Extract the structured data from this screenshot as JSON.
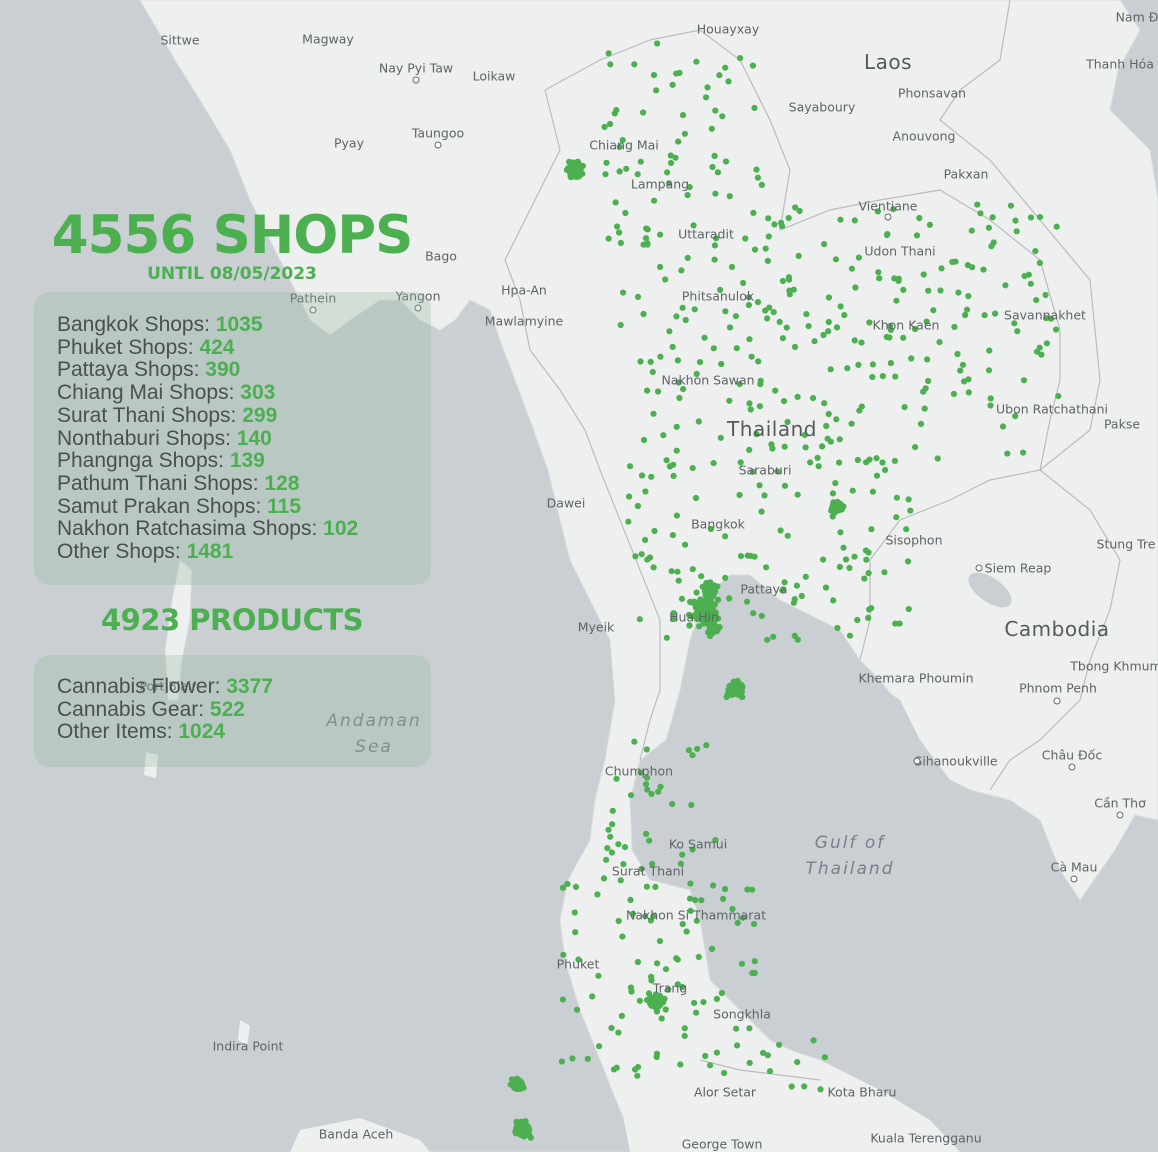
{
  "colors": {
    "sea": "#c9cfd3",
    "land": "#eeefef",
    "shop_dot": "#4caf50",
    "accent": "#4caf50",
    "panel": "rgba(143,184,150,0.28)"
  },
  "summary": {
    "shops_headline": "4556 SHOPS",
    "until": "UNTIL 08/05/2023",
    "products_headline": "4923 PRODUCTS"
  },
  "shops": [
    {
      "label": "Bangkok Shops: ",
      "value": "1035"
    },
    {
      "label": "Phuket Shops: ",
      "value": "424"
    },
    {
      "label": "Pattaya Shops: ",
      "value": "390"
    },
    {
      "label": "Chiang Mai Shops: ",
      "value": "303"
    },
    {
      "label": "Surat Thani Shops: ",
      "value": "299"
    },
    {
      "label": "Nonthaburi Shops: ",
      "value": "140"
    },
    {
      "label": "Phangnga Shops: ",
      "value": "139"
    },
    {
      "label": "Pathum Thani Shops: ",
      "value": "128"
    },
    {
      "label": "Samut Prakan Shops: ",
      "value": "115"
    },
    {
      "label": "Nakhon Ratchasima Shops: ",
      "value": "102"
    },
    {
      "label": "Other Shops: ",
      "value": "1481"
    }
  ],
  "products": [
    {
      "label": "Cannabis Flower: ",
      "value": "3377"
    },
    {
      "label": "Cannabis Gear: ",
      "value": "522"
    },
    {
      "label": "Other Items: ",
      "value": "1024"
    }
  ],
  "map_labels": {
    "countries": [
      "Laos",
      "Thailand",
      "Cambodia"
    ],
    "water": [
      "Andaman Sea",
      "Gulf of Thailand"
    ],
    "places": [
      "Houayxay",
      "Nam Đ",
      "Sittwe",
      "Magway",
      "Nay Pyi Taw",
      "Loikaw",
      "Thanh Hóa",
      "Phonsavan",
      "Sayaboury",
      "Pyay",
      "Taungoo",
      "Anouvong",
      "Chiang Mai",
      "Lampang",
      "Pakxan",
      "Vientiane",
      "Uttaradit",
      "Udon Thani",
      "Bago",
      "Pathein",
      "Yangon",
      "Hpa-An",
      "Phitsanulok",
      "Mawlamyine",
      "Khon Kaen",
      "Savannakhet",
      "Nakhon Sawan",
      "Ubon Ratchathani",
      "Pakse",
      "Saraburi",
      "Dawei",
      "Bangkok",
      "Sisophon",
      "Siem Reap",
      "Stung Tre",
      "Pattaya",
      "Myeik",
      "Hua Hin",
      "Khemara Phoumin",
      "Tbong Khmum",
      "Phnom Penh",
      "Port Blair",
      "Sihanoukville",
      "Châu Đốc",
      "Chumphon",
      "Cần Thơ",
      "Ko Samui",
      "Cà Mau",
      "Surat Thani",
      "Nakhon Si Thammarat",
      "Phuket",
      "Trang",
      "Songkhla",
      "Indira Point",
      "Alor Setar",
      "Kota Bharu",
      "Banda Aceh",
      "George Town",
      "Kuala Terengganu"
    ]
  },
  "shop_locations": [
    [
      100.53,
      13.8,
      1035
    ],
    [
      98.36,
      7.95,
      424
    ],
    [
      100.9,
      12.92,
      390
    ],
    [
      98.98,
      18.79,
      303
    ],
    [
      99.95,
      9.4,
      299
    ],
    [
      100.5,
      13.86,
      140
    ],
    [
      98.3,
      8.45,
      139
    ],
    [
      100.6,
      14.05,
      128
    ],
    [
      100.62,
      13.6,
      115
    ],
    [
      102.09,
      14.97,
      102
    ]
  ]
}
